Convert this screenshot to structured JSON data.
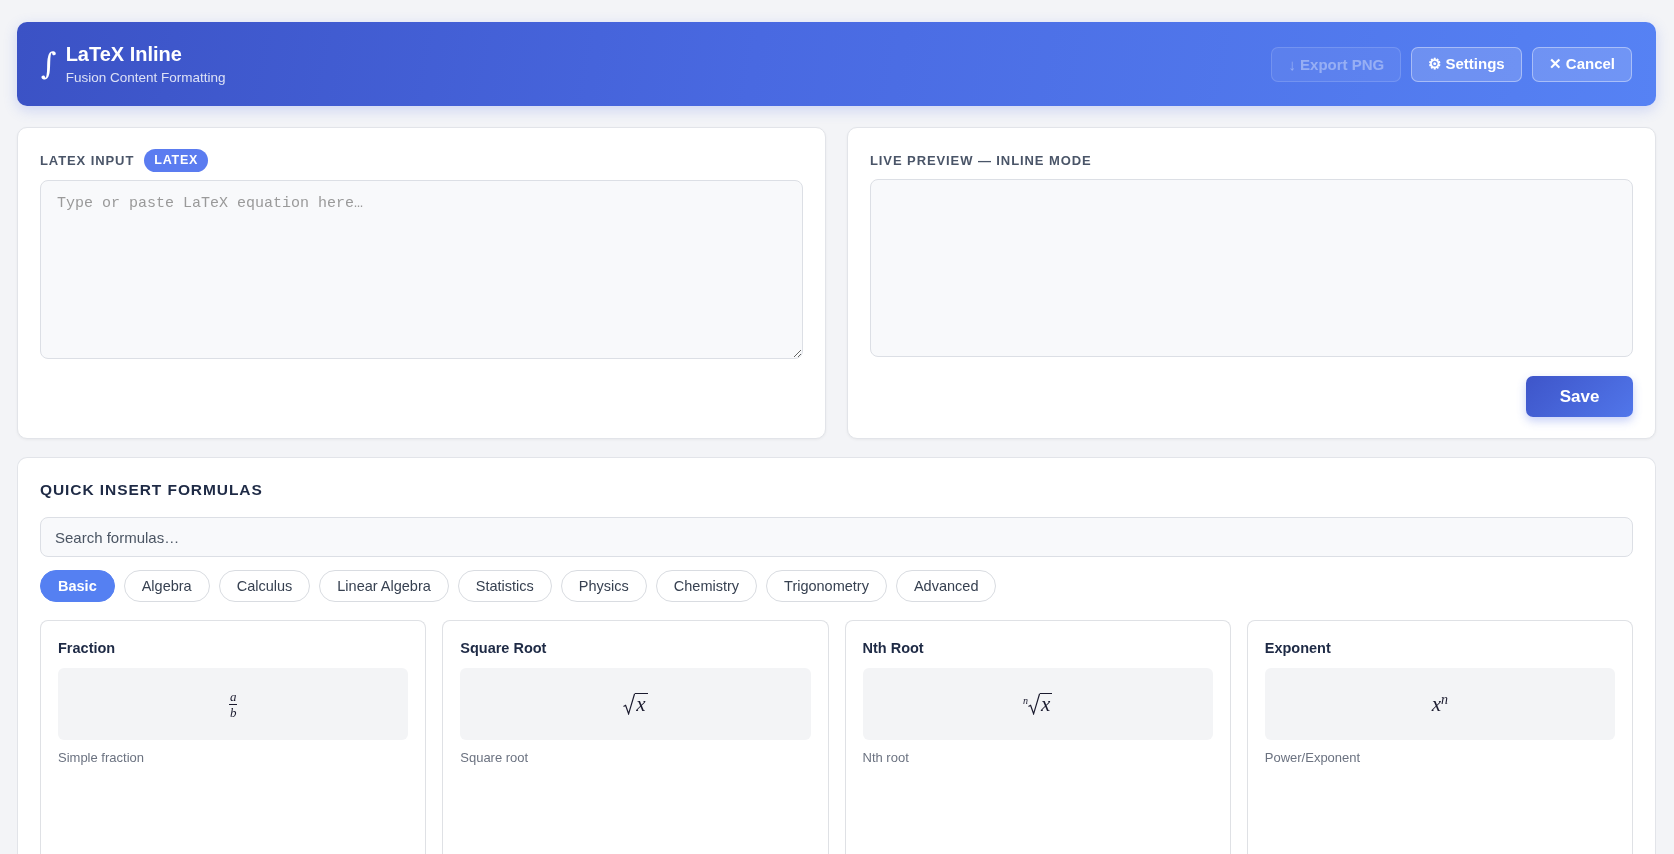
{
  "header": {
    "logo": "∫",
    "title": "LaTeX Inline",
    "subtitle": "Fusion Content Formatting",
    "buttons": [
      {
        "label": "↓ Export PNG",
        "disabled": true
      },
      {
        "label": "⚙ Settings",
        "disabled": false
      },
      {
        "label": "✕ Cancel",
        "disabled": false
      }
    ]
  },
  "input_panel": {
    "label": "LATEX INPUT",
    "badge": "LATEX",
    "editor": {
      "placeholder": "Type or paste LaTeX equation here…"
    }
  },
  "preview_panel": {
    "label": "LIVE PREVIEW — INLINE MODE",
    "save_button": "Save"
  },
  "formulas": {
    "title": "QUICK INSERT FORMULAS",
    "search": {
      "placeholder": "Search formulas…"
    },
    "categories": [
      {
        "label": "Basic",
        "selected": true
      },
      {
        "label": "Algebra",
        "selected": false
      },
      {
        "label": "Calculus",
        "selected": false
      },
      {
        "label": "Linear Algebra",
        "selected": false
      },
      {
        "label": "Statistics",
        "selected": false
      },
      {
        "label": "Physics",
        "selected": false
      },
      {
        "label": "Chemistry",
        "selected": false
      },
      {
        "label": "Trigonometry",
        "selected": false
      },
      {
        "label": "Advanced",
        "selected": false
      }
    ],
    "cards": [
      {
        "title": "Fraction",
        "formula": {
          "kind": "fraction",
          "numerator": "a",
          "denominator": "b"
        },
        "description": "Simple fraction"
      },
      {
        "title": "Square Root",
        "formula": {
          "kind": "sqrt",
          "radicand": "x"
        },
        "description": "Square root"
      },
      {
        "title": "Nth Root",
        "formula": {
          "kind": "nthroot",
          "index": "n",
          "radicand": "x"
        },
        "description": "Nth root"
      },
      {
        "title": "Exponent",
        "formula": {
          "kind": "power",
          "expression": "x$^{n}$"
        },
        "description": "Power/Exponent"
      }
    ]
  }
}
